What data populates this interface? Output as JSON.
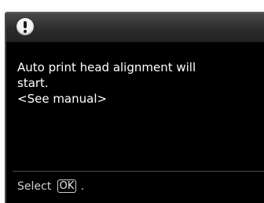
{
  "dialog": {
    "icon": "exclamation-icon",
    "message_lines": [
      "Auto print head alignment will",
      "start.",
      "<See manual>"
    ]
  },
  "footer": {
    "select_label": "Select",
    "ok_key_label": "OK",
    "trailing_text": "."
  }
}
